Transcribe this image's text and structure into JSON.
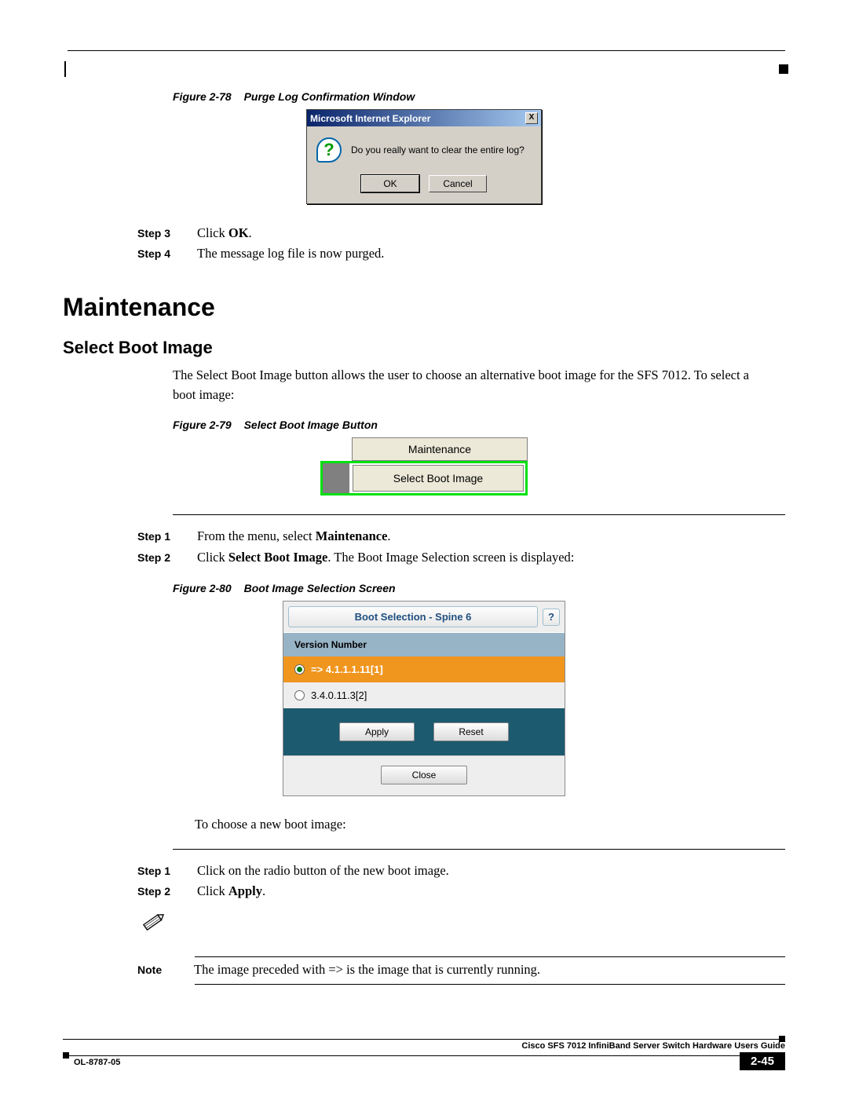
{
  "figures": {
    "f78": {
      "label": "Figure 2-78",
      "title": "Purge Log Confirmation Window"
    },
    "f79": {
      "label": "Figure 2-79",
      "title": "Select Boot Image Button"
    },
    "f80": {
      "label": "Figure 2-80",
      "title": "Boot Image Selection Screen"
    }
  },
  "dialog78": {
    "titlebar": "Microsoft Internet Explorer",
    "close": "X",
    "question_mark": "?",
    "message": "Do you really want to clear the entire log?",
    "ok": "OK",
    "cancel": "Cancel"
  },
  "steps_a": {
    "s3_label": "Step 3",
    "s3_pre": "Click ",
    "s3_bold": "OK",
    "s3_post": ".",
    "s4_label": "Step 4",
    "s4_text": "The message log file is now purged."
  },
  "headings": {
    "h1": "Maintenance",
    "h2": "Select Boot Image"
  },
  "intro_text": "The Select Boot Image button allows the user to choose an alternative boot image for the SFS 7012. To select a boot image:",
  "menu79": {
    "line1": "Maintenance",
    "line2": "Select Boot Image"
  },
  "steps_b": {
    "s1_label": "Step 1",
    "s1_pre": "From the menu, select ",
    "s1_bold": "Maintenance",
    "s1_post": ".",
    "s2_label": "Step 2",
    "s2_pre": "Click ",
    "s2_bold": "Select Boot Image",
    "s2_post": ". The Boot Image Selection screen is displayed:"
  },
  "boot": {
    "title": "Boot Selection - Spine 6",
    "help": "?",
    "header": "Version Number",
    "opt1": "=> 4.1.1.1.11[1]",
    "opt2": "3.4.0.11.3[2]",
    "apply": "Apply",
    "reset": "Reset",
    "close": "Close"
  },
  "choose_text": "To choose a new boot image:",
  "steps_c": {
    "s1_label": "Step 1",
    "s1_text": "Click on the radio button of the new boot image.",
    "s2_label": "Step 2",
    "s2_pre": "Click ",
    "s2_bold": "Apply",
    "s2_post": "."
  },
  "note": {
    "label": "Note",
    "text": "The image preceded with => is the image that is currently running."
  },
  "footer": {
    "guide": "Cisco SFS 7012 InfiniBand Server Switch Hardware Users Guide",
    "doc": "OL-8787-05",
    "page": "2-45"
  }
}
